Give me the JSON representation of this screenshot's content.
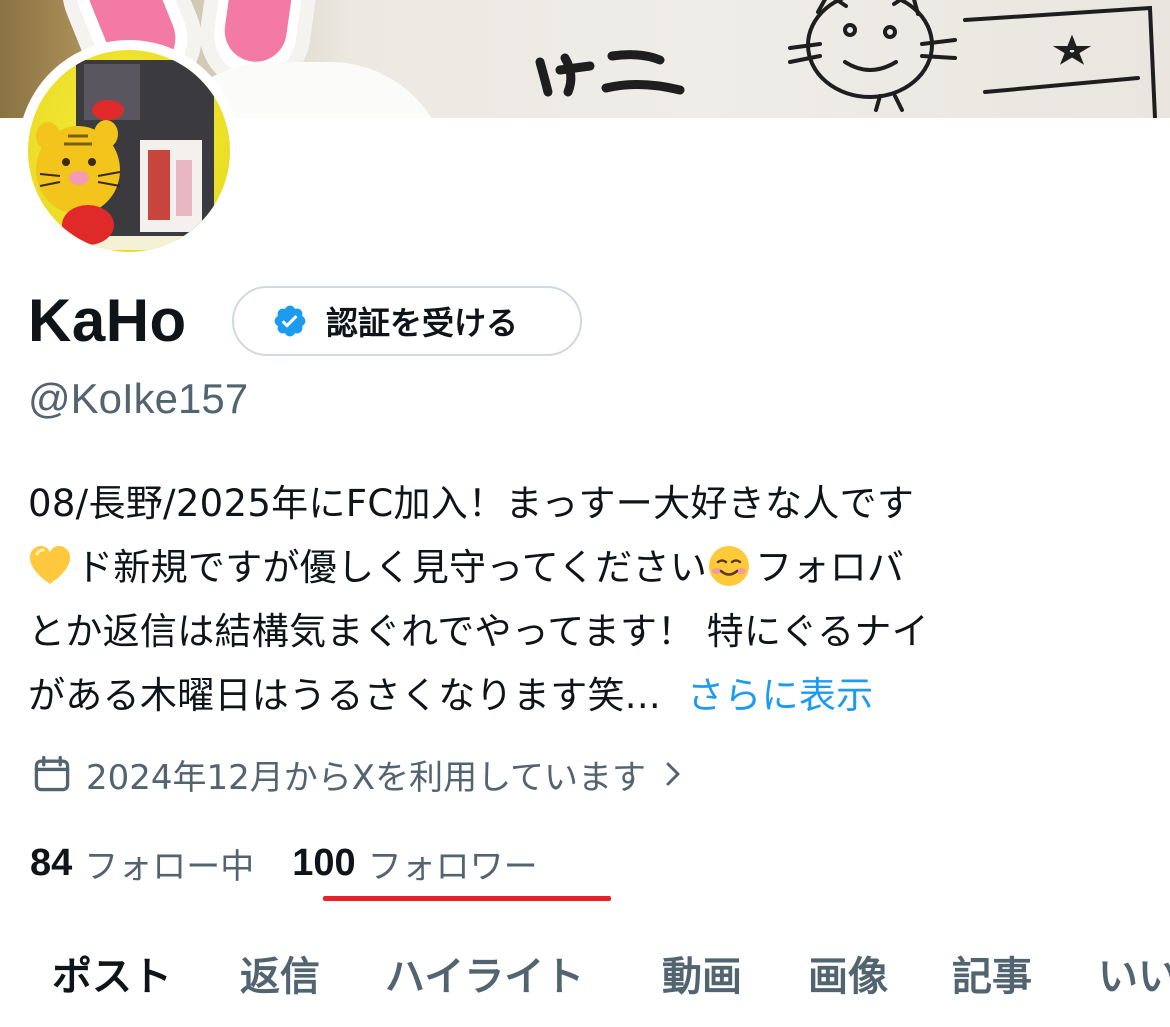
{
  "profile": {
    "display_name": "KaHo",
    "verify_button_label": "認証を受ける",
    "handle": "@KoIke157",
    "bio": {
      "line1": "08/長野/2025年にFC加入！まっすー大好きな人です",
      "line2": "ド新規ですが優しく見守ってください",
      "line2_tail": "フォロバ",
      "line3": "とか返信は結構気まぐれでやってます！ 特にぐるナイ",
      "line4": "がある木曜日はうるさくなります笑...",
      "show_more": "さらに表示",
      "emoji_1": "yellow-heart",
      "emoji_2": "smiling-face"
    },
    "joined": "2024年12月からXを利用しています",
    "following_count": "84",
    "following_label": "フォロー中",
    "followers_count": "100",
    "followers_label": "フォロワー"
  },
  "tabs": [
    {
      "label": "ポスト",
      "active": true
    },
    {
      "label": "返信",
      "active": false
    },
    {
      "label": "ハイライト",
      "active": false
    },
    {
      "label": "動画",
      "active": false
    },
    {
      "label": "画像",
      "active": false
    },
    {
      "label": "記事",
      "active": false
    },
    {
      "label": "いい",
      "active": false
    }
  ],
  "colors": {
    "text_primary": "#0f1419",
    "text_secondary": "#536471",
    "link": "#1d9bf0",
    "verified_badge": "#1d9bf0",
    "annotation_underline": "#e8202a"
  },
  "icons": {
    "verified": "verified-badge-icon",
    "calendar": "calendar-icon",
    "chevron": "chevron-right-icon"
  }
}
